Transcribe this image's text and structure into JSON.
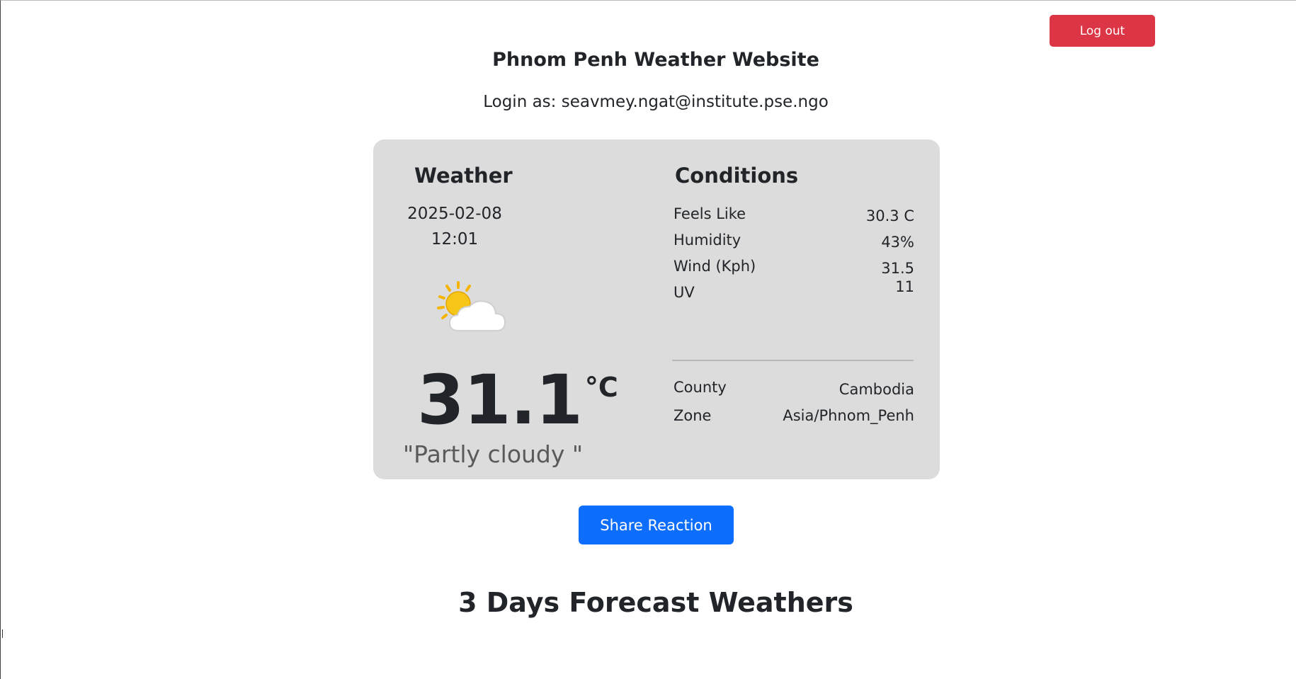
{
  "header": {
    "logout_label": "Log out",
    "site_title": "Phnom Penh Weather Website",
    "login_text": "Login as: seavmey.ngat@institute.pse.ngo"
  },
  "weather": {
    "heading": "Weather",
    "date": "2025-02-08",
    "time": "12:01",
    "icon": "partly-cloudy-icon",
    "temperature": "31.1",
    "unit": "°C",
    "condition": "\"Partly cloudy \""
  },
  "conditions": {
    "heading": "Conditions",
    "rows": [
      {
        "label": "Feels Like",
        "value": "30.3 C"
      },
      {
        "label": "Humidity",
        "value": "43%"
      },
      {
        "label": "Wind (Kph)",
        "value": "31.5"
      },
      {
        "label": "UV",
        "value": "11"
      }
    ],
    "location": [
      {
        "label": "County",
        "value": "Cambodia"
      },
      {
        "label": "Zone",
        "value": "Asia/Phnom_Penh"
      }
    ]
  },
  "actions": {
    "share_label": "Share Reaction"
  },
  "forecast": {
    "heading": "3 Days Forecast Weathers"
  },
  "colors": {
    "danger": "#dc3545",
    "primary": "#0d6efd",
    "card_bg": "#dcdcdc"
  }
}
